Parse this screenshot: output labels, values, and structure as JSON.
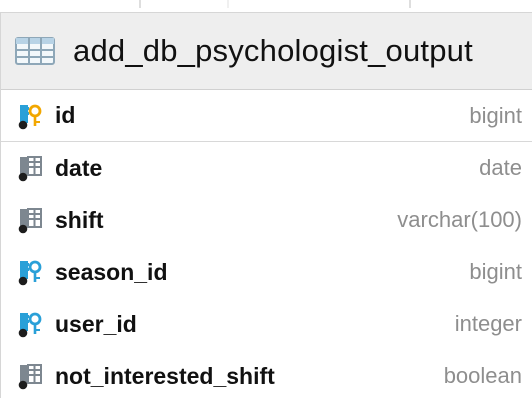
{
  "table": {
    "title": "add_db_psychologist_output",
    "icon": "table-icon"
  },
  "columns": [
    {
      "name": "id",
      "type": "bigint",
      "icon": "primary-key-icon",
      "is_primary_key": true
    },
    {
      "name": "date",
      "type": "date",
      "icon": "column-icon",
      "is_primary_key": false
    },
    {
      "name": "shift",
      "type": "varchar(100)",
      "icon": "column-icon",
      "is_primary_key": false
    },
    {
      "name": "season_id",
      "type": "bigint",
      "icon": "foreign-key-icon",
      "is_primary_key": false
    },
    {
      "name": "user_id",
      "type": "integer",
      "icon": "foreign-key-icon",
      "is_primary_key": false
    },
    {
      "name": "not_interested_shift",
      "type": "boolean",
      "icon": "column-icon",
      "is_primary_key": false
    }
  ],
  "colors": {
    "header_background": "#eeeeee",
    "border": "#d6d6d6",
    "column_name": "#111111",
    "column_type": "#8e8e8e",
    "key_gold": "#f2a700",
    "foreign_key_blue": "#2aa0d8",
    "column_icon_gray": "#7d8790"
  }
}
